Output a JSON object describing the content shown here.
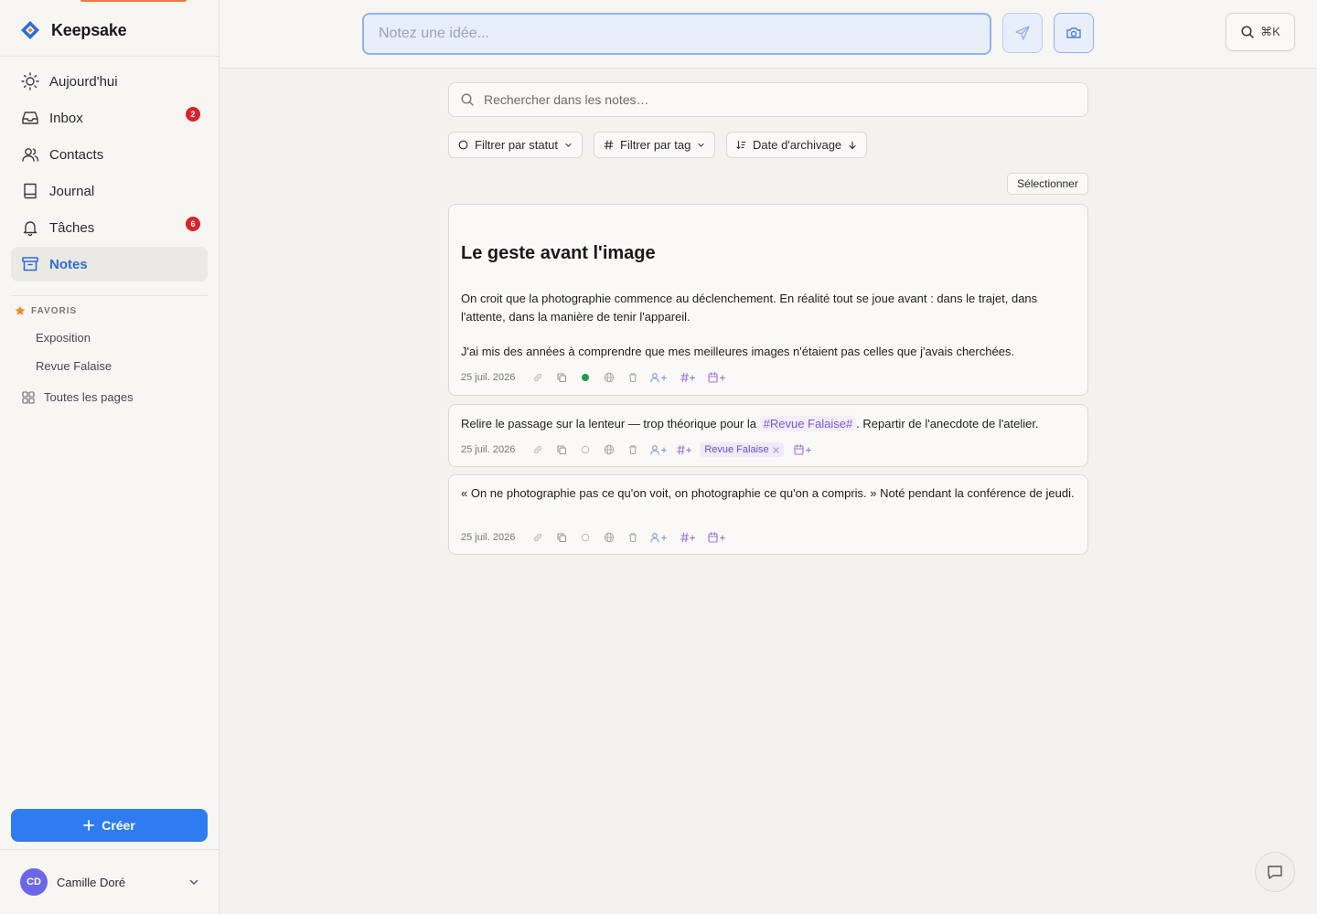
{
  "app": {
    "name": "Keepsake"
  },
  "sidebar": {
    "nav": [
      {
        "label": "Aujourd'hui",
        "icon": "sun-icon"
      },
      {
        "label": "Inbox",
        "icon": "inbox-icon",
        "badge": "2"
      },
      {
        "label": "Contacts",
        "icon": "users-icon"
      },
      {
        "label": "Journal",
        "icon": "book-icon"
      },
      {
        "label": "Tâches",
        "icon": "bell-icon",
        "badge": "6"
      },
      {
        "label": "Notes",
        "icon": "archive-icon",
        "active": true
      }
    ],
    "favorites": {
      "header": "FAVORIS",
      "items": [
        "Exposition",
        "Revue Falaise"
      ],
      "all_pages": "Toutes les pages"
    },
    "create_label": "Créer",
    "user": {
      "initials": "CD",
      "name": "Camille Doré"
    }
  },
  "topbar": {
    "idea_placeholder": "Notez une idée...",
    "shortcut": "⌘K"
  },
  "main": {
    "search_placeholder": "Rechercher dans les notes…",
    "filters": {
      "status": "Filtrer par statut",
      "tag": "Filtrer par tag",
      "sort": "Date d'archivage"
    },
    "select_label": "Sélectionner",
    "notes": [
      {
        "title": "Le geste avant l'image",
        "paragraphs": [
          "On croit que la photographie commence au déclenchement. En réalité tout se joue avant : dans le trajet, dans l'attente, dans la manière de tenir l'appareil.",
          "J'ai mis des années à comprendre que mes meilleures images n'étaient pas celles que j'avais cherchées."
        ],
        "date": "25 juil. 2026",
        "status": "done"
      },
      {
        "text_before": "Relire le passage sur la lenteur — trop théorique pour la ",
        "inline_tag": "#Revue Falaise#",
        "text_after": ". Repartir de l'anecdote de l'atelier.",
        "date": "25 juil. 2026",
        "tag_chip": "Revue Falaise"
      },
      {
        "text": "« On ne photographie pas ce qu'on voit, on photographie ce qu'on a compris. » Noté pendant la conférence de jeudi.",
        "date": "25 juil. 2026"
      }
    ]
  },
  "colors": {
    "accent": "#2f7cf0",
    "active_nav": "#2f6bd8",
    "badge": "#d8232a",
    "tag": "#7d55d9",
    "status_done": "#1f9d4c"
  }
}
